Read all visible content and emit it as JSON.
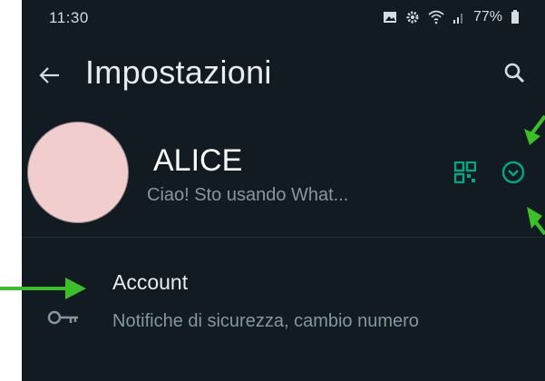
{
  "status_bar": {
    "time": "11:30",
    "battery": "77%",
    "icons": [
      "gallery-icon",
      "settings-gear-icon",
      "wifi-icon",
      "signal-icon",
      "battery-icon"
    ]
  },
  "app_bar": {
    "title": "Impostazioni",
    "back_icon": "arrow-left-icon",
    "search_icon": "search-icon"
  },
  "profile": {
    "name": "ALICE",
    "about": "Ciao! Sto usando What...",
    "qr_icon": "qr-code-icon",
    "expand_icon": "chevron-down-circle-icon",
    "avatar_color": "#f2cdcd"
  },
  "settings": [
    {
      "title": "Account",
      "subtitle": "Notifiche di sicurezza, cambio numero",
      "icon": "key-icon"
    }
  ],
  "colors": {
    "background": "#121b22",
    "accent": "#00a884",
    "annotation_arrow": "#3cc02a",
    "primary_text": "#e9edef",
    "secondary_text": "#8696a0"
  }
}
